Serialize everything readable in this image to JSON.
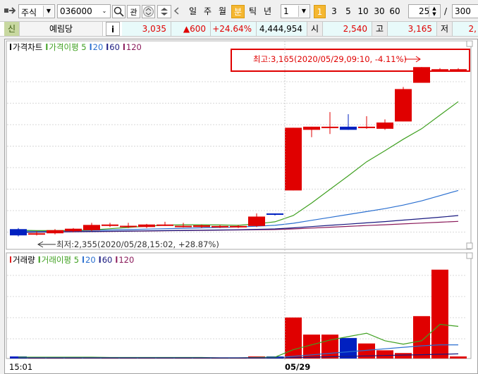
{
  "toolbar": {
    "market": "주식",
    "code": "036000",
    "btn_watch": "관",
    "periods": [
      "일",
      "주",
      "월",
      "분",
      "틱",
      "년"
    ],
    "active_period": "분",
    "interval_value": "1",
    "minute_buttons": [
      "1",
      "3",
      "5",
      "10",
      "30",
      "60"
    ],
    "active_minute": "1",
    "count_value": "25",
    "slash": "/",
    "total_value": "300"
  },
  "info": {
    "badge": "신",
    "name": "예림당",
    "info_btn": "i",
    "price": "3,035",
    "change": "▲600",
    "change_pct": "+24.64%",
    "volume": "4,444,954",
    "open_label": "시",
    "open_value": "2,540",
    "high_label": "고",
    "high_value": "3,165",
    "low_label": "저",
    "low_value": "2,"
  },
  "price_pane": {
    "legend": [
      {
        "text": "가격차트",
        "color": "#000000"
      },
      {
        "text": "가격이평 5",
        "color": "#3fa020"
      },
      {
        "text": "20",
        "color": "#2a6fd0"
      },
      {
        "text": "60",
        "color": "#1a1a80"
      },
      {
        "text": "120",
        "color": "#8a1a5a"
      }
    ],
    "high_annotation": "최고:3,165(2020/05/29,09:10, -4.11%)",
    "low_annotation": "최저:2,355(2020/05/28,15:02, +28.87%)"
  },
  "volume_pane": {
    "legend": [
      {
        "text": "거래량",
        "color": "#e02020"
      },
      {
        "text": "거래이평 5",
        "color": "#3fa020"
      },
      {
        "text": "20",
        "color": "#2a6fd0"
      },
      {
        "text": "60",
        "color": "#1a1a80"
      },
      {
        "text": "120",
        "color": "#8a1a5a"
      }
    ]
  },
  "x_axis": {
    "left_label": "15:01",
    "date_label": "05/29"
  },
  "colors": {
    "up": "#e00000",
    "down": "#0020c0",
    "ma5": "#3fa020",
    "ma20": "#2a6fd0",
    "ma60": "#1a1a80",
    "ma120": "#8a1a5a",
    "highlight": "#f5b731"
  },
  "chart_data": {
    "type": "candlestick",
    "units": "KRW",
    "candles": [
      {
        "open": 2390,
        "high": 2395,
        "low": 2355,
        "close": 2360
      },
      {
        "open": 2365,
        "high": 2380,
        "low": 2360,
        "close": 2370
      },
      {
        "open": 2370,
        "high": 2390,
        "low": 2365,
        "close": 2385
      },
      {
        "open": 2380,
        "high": 2395,
        "low": 2375,
        "close": 2392
      },
      {
        "open": 2385,
        "high": 2420,
        "low": 2380,
        "close": 2410
      },
      {
        "open": 2410,
        "high": 2420,
        "low": 2400,
        "close": 2412
      },
      {
        "open": 2402,
        "high": 2420,
        "low": 2395,
        "close": 2406
      },
      {
        "open": 2400,
        "high": 2415,
        "low": 2395,
        "close": 2412
      },
      {
        "open": 2410,
        "high": 2425,
        "low": 2405,
        "close": 2412
      },
      {
        "open": 2402,
        "high": 2420,
        "low": 2398,
        "close": 2406
      },
      {
        "open": 2400,
        "high": 2412,
        "low": 2395,
        "close": 2408
      },
      {
        "open": 2405,
        "high": 2410,
        "low": 2395,
        "close": 2405
      },
      {
        "open": 2405,
        "high": 2410,
        "low": 2395,
        "close": 2405
      },
      {
        "open": 2405,
        "high": 2465,
        "low": 2400,
        "close": 2450
      },
      {
        "open": 2465,
        "high": 2465,
        "low": 2455,
        "close": 2460
      },
      {
        "open": 2575,
        "high": 2875,
        "low": 2575,
        "close": 2875
      },
      {
        "open": 2865,
        "high": 2880,
        "low": 2830,
        "close": 2880
      },
      {
        "open": 2875,
        "high": 2950,
        "low": 2845,
        "close": 2880
      },
      {
        "open": 2880,
        "high": 2940,
        "low": 2865,
        "close": 2865
      },
      {
        "open": 2875,
        "high": 2930,
        "low": 2870,
        "close": 2880
      },
      {
        "open": 2870,
        "high": 2915,
        "low": 2865,
        "close": 2900
      },
      {
        "open": 2905,
        "high": 3070,
        "low": 2905,
        "close": 3060
      },
      {
        "open": 3090,
        "high": 3165,
        "low": 3090,
        "close": 3165
      },
      {
        "open": 3155,
        "high": 3160,
        "low": 3150,
        "close": 3155
      },
      {
        "open": 3155,
        "high": 3160,
        "low": 3150,
        "close": 3155
      }
    ],
    "ma5": [
      2385,
      2383,
      2383,
      2384,
      2386,
      2392,
      2398,
      2404,
      2409,
      2411,
      2411,
      2410,
      2408,
      2415,
      2425,
      2455,
      2515,
      2580,
      2645,
      2712,
      2765,
      2820,
      2870,
      2935,
      3000
    ],
    "ma20": [
      2380,
      2381,
      2382,
      2383,
      2384,
      2386,
      2388,
      2390,
      2392,
      2394,
      2396,
      2398,
      2400,
      2404,
      2408,
      2418,
      2432,
      2446,
      2460,
      2474,
      2488,
      2505,
      2525,
      2550,
      2575
    ],
    "ma60": [
      2375,
      2376,
      2377,
      2378,
      2379,
      2380,
      2381,
      2382,
      2383,
      2384,
      2385,
      2386,
      2387,
      2389,
      2391,
      2396,
      2402,
      2408,
      2414,
      2420,
      2426,
      2433,
      2440,
      2447,
      2455
    ],
    "ma120": [
      2374,
      2375,
      2376,
      2377,
      2378,
      2379,
      2380,
      2381,
      2382,
      2383,
      2384,
      2385,
      2386,
      2387,
      2388,
      2391,
      2395,
      2399,
      2403,
      2407,
      2411,
      2415,
      2419,
      2423,
      2427
    ],
    "volume": [
      3,
      1,
      1,
      1,
      2,
      1,
      1,
      1,
      2,
      1,
      1,
      1,
      1,
      3,
      3,
      60,
      35,
      35,
      30,
      22,
      12,
      8,
      62,
      130,
      3
    ],
    "volume_ma5": [
      2,
      2,
      2,
      2,
      2,
      1.5,
      1.5,
      1.5,
      1.5,
      1.5,
      1.5,
      1,
      1,
      1.5,
      2,
      13,
      20,
      27,
      32,
      37,
      26,
      21,
      26,
      50,
      47
    ]
  }
}
